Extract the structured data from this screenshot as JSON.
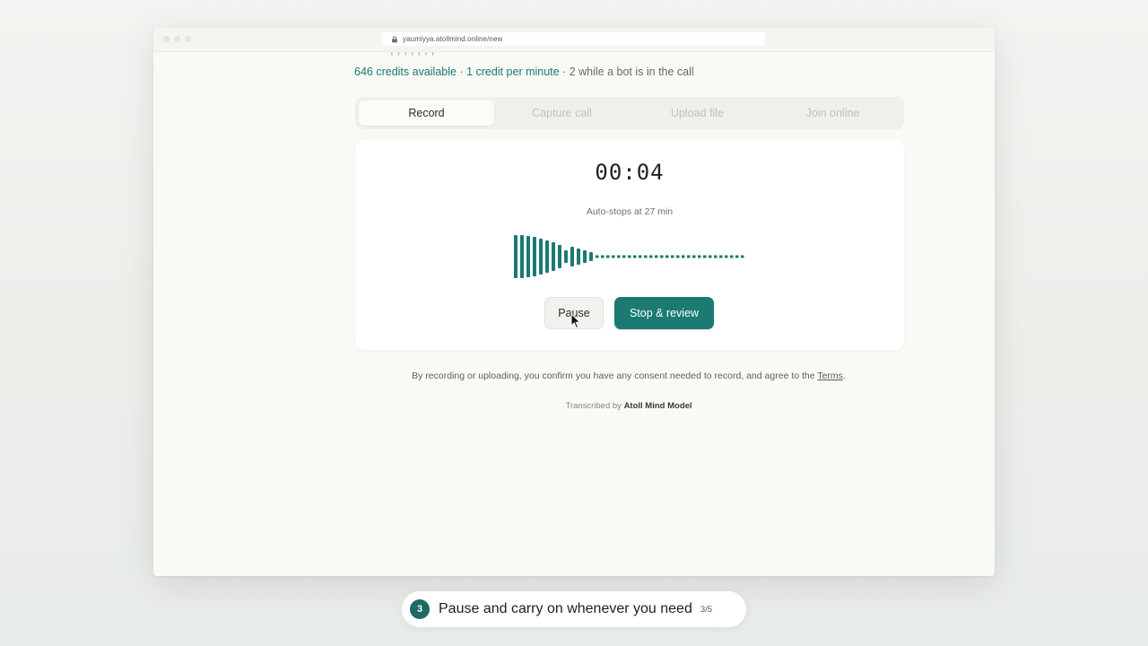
{
  "browser": {
    "url": "yaumiyya.atollmind.online/new"
  },
  "credits": {
    "available": "646 credits available",
    "rate": " · 1 credit per minute",
    "bot_rate": " · 2 while a bot is in the call"
  },
  "tabs": [
    {
      "label": "Record",
      "active": true
    },
    {
      "label": "Capture call",
      "active": false
    },
    {
      "label": "Upload file",
      "active": false
    },
    {
      "label": "Join online",
      "active": false
    }
  ],
  "recorder": {
    "timer": "00:04",
    "autostop": "Auto-stops at 27 min",
    "pause_label": "Pause",
    "stop_label": "Stop & review"
  },
  "footer": {
    "consent_text": "By recording or uploading, you confirm you have any consent needed to record, and agree to the ",
    "terms_link": "Terms",
    "consent_end": ".",
    "transcribed_prefix": "Transcribed by ",
    "transcribed_model": "Atoll Mind Model"
  },
  "step": {
    "number": "3",
    "text": "Pause and carry on whenever you need",
    "count": "3/5"
  },
  "colors": {
    "accent": "#1b7a72",
    "step_badge": "#1b6b63"
  },
  "icons": {
    "lock": "lock-icon",
    "cursor": "mouse-cursor-icon"
  }
}
